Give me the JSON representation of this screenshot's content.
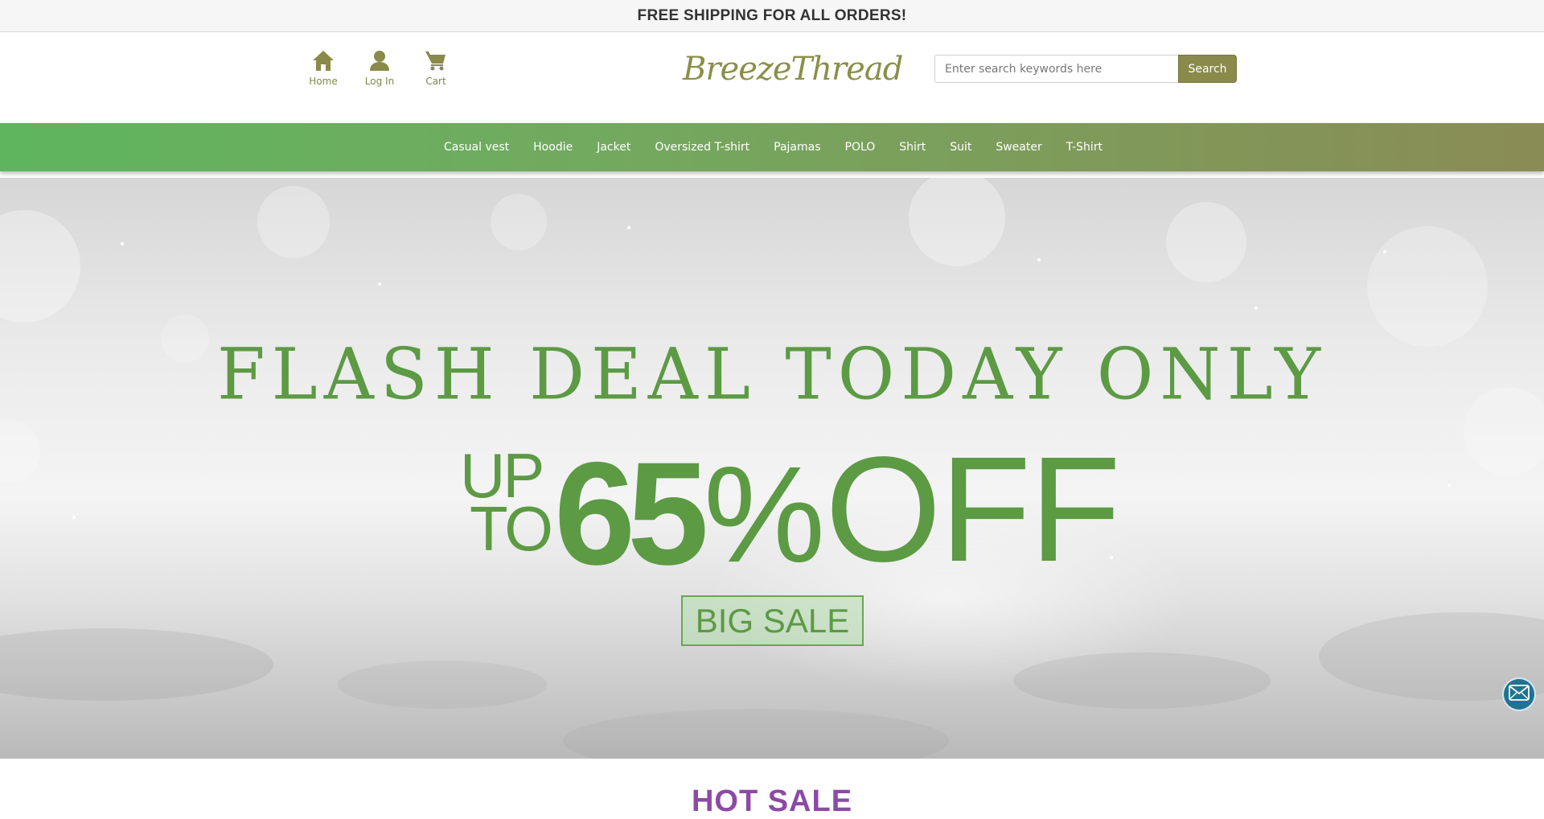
{
  "announcement": "FREE SHIPPING FOR ALL ORDERS!",
  "quick_links": [
    {
      "label": "Home",
      "icon": "home-icon"
    },
    {
      "label": "Log In",
      "icon": "user-icon"
    },
    {
      "label": "Cart",
      "icon": "cart-icon"
    }
  ],
  "brand": {
    "logo_text": "BreezeThread",
    "color": "#8a8f48"
  },
  "search": {
    "placeholder": "Enter search keywords here",
    "value": "",
    "button_label": "Search"
  },
  "nav": {
    "items": [
      "Casual vest",
      "Hoodie",
      "Jacket",
      "Oversized T-shirt",
      "Pajamas",
      "POLO",
      "Shirt",
      "Suit",
      "Sweater",
      "T-Shirt"
    ],
    "gradient": [
      "#5eb55e",
      "#8a8c55"
    ]
  },
  "hero": {
    "headline": "FLASH DEAL TODAY ONLY",
    "offer_up": "UP",
    "offer_to": "TO",
    "offer_number": "65",
    "offer_percent": "%",
    "offer_off": "OFF",
    "cta_label": "BIG SALE",
    "accent_color": "#5c9a44"
  },
  "contact": {
    "icon": "mail-icon",
    "color": "#1f7393"
  },
  "next_section": {
    "title": "HOT SALE",
    "color": "#8c4aa5"
  }
}
